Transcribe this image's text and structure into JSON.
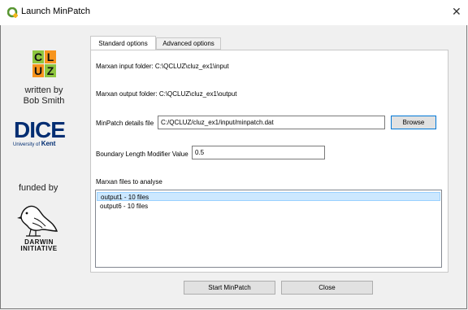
{
  "window": {
    "title": "Launch MinPatch",
    "close_glyph": "✕"
  },
  "sidebar": {
    "cluz_letters": [
      "C",
      "L",
      "U",
      "Z"
    ],
    "written_by": "written by",
    "author": "Bob Smith",
    "dice": "DICE",
    "university_prefix": "University of",
    "university_name": "Kent",
    "funded_by": "funded by",
    "darwin_line1": "DARWIN",
    "darwin_line2": "INITIATIVE"
  },
  "tabs": [
    {
      "label": "Standard options",
      "active": true
    },
    {
      "label": "Advanced options",
      "active": false
    }
  ],
  "form": {
    "input_folder_label": "Marxan input folder: C:\\QCLUZ\\cluz_ex1\\input",
    "output_folder_label": "Marxan output folder: C:\\QCLUZ\\cluz_ex1\\output",
    "details_file_label": "MinPatch details file",
    "details_file_value": "C:/QCLUZ/cluz_ex1/input/minpatch.dat",
    "browse_label": "Browse",
    "blm_label": "Boundary Length Modifier Value",
    "blm_value": "0.5",
    "files_label": "Marxan files to analyse",
    "files": [
      {
        "label": "output1 - 10 files",
        "selected": true
      },
      {
        "label": "output6 - 10 files",
        "selected": false
      }
    ]
  },
  "buttons": {
    "start": "Start MinPatch",
    "close": "Close"
  },
  "colors": {
    "dice_blue": "#002d72",
    "selection": "#cce8ff",
    "qgis_green": "#589632"
  }
}
